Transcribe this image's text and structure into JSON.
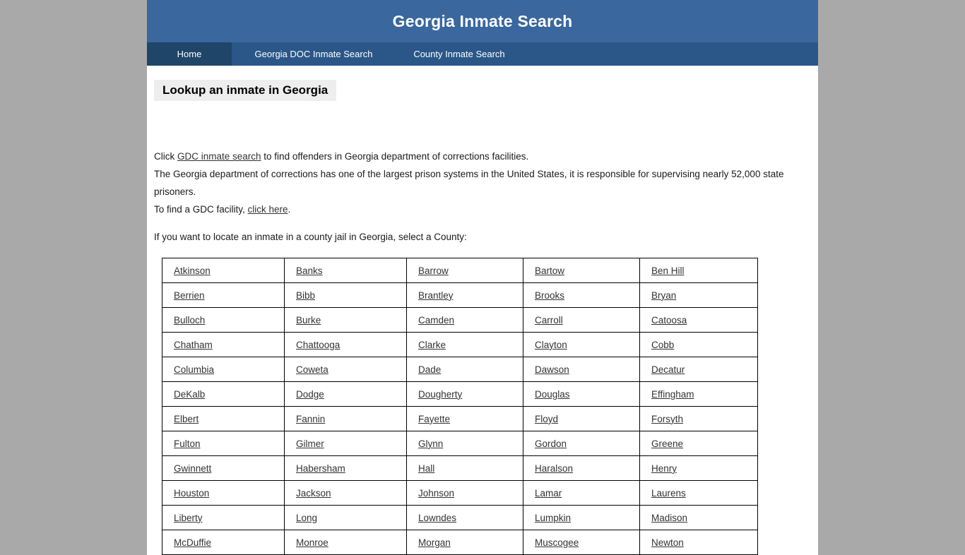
{
  "header": {
    "title": "Georgia Inmate Search"
  },
  "nav": {
    "items": [
      {
        "label": "Home",
        "active": true
      },
      {
        "label": "Georgia DOC Inmate Search",
        "active": false
      },
      {
        "label": "County Inmate Search",
        "active": false
      }
    ]
  },
  "main": {
    "heading": "Lookup an inmate in Georgia",
    "paragraph1": {
      "before": "Click ",
      "link": "GDC inmate search",
      "after": " to find offenders in Georgia department of corrections facilities."
    },
    "paragraph2": "The Georgia department of corrections has one of the largest prison systems in the United States, it is responsible for supervising nearly 52,000 state prisoners.",
    "paragraph3": {
      "before": "To find a GDC facility, ",
      "link": "click here",
      "after": "."
    },
    "paragraph4": "If you want to locate an inmate in a county jail in Georgia, select a County:"
  },
  "county_table": {
    "rows": [
      [
        "Atkinson",
        "Banks",
        "Barrow",
        "Bartow",
        "Ben Hill"
      ],
      [
        "Berrien",
        "Bibb",
        "Brantley",
        "Brooks",
        "Bryan"
      ],
      [
        "Bulloch",
        "Burke",
        "Camden",
        "Carroll",
        "Catoosa"
      ],
      [
        "Chatham",
        "Chattooga",
        "Clarke",
        "Clayton",
        "Cobb"
      ],
      [
        "Columbia",
        "Coweta",
        "Dade",
        "Dawson",
        "Decatur"
      ],
      [
        "DeKalb",
        "Dodge",
        "Dougherty",
        "Douglas",
        "Effingham"
      ],
      [
        "Elbert",
        "Fannin",
        "Fayette",
        "Floyd",
        "Forsyth"
      ],
      [
        "Fulton",
        "Gilmer",
        "Glynn",
        "Gordon",
        "Greene"
      ],
      [
        "Gwinnett",
        "Habersham",
        "Hall",
        "Haralson",
        "Henry"
      ],
      [
        "Houston",
        "Jackson",
        "Johnson",
        "Lamar",
        "Laurens"
      ],
      [
        "Liberty",
        "Long",
        "Lowndes",
        "Lumpkin",
        "Madison"
      ],
      [
        "McDuffie",
        "Monroe",
        "Morgan",
        "Muscogee",
        "Newton"
      ]
    ]
  },
  "colors": {
    "page_background": "#a9a9a9",
    "header_blue": "#39679e",
    "nav_blue": "#2a5788",
    "nav_active_blue": "#1f4568",
    "heading_background": "#eeeeee",
    "link": "#333333"
  }
}
